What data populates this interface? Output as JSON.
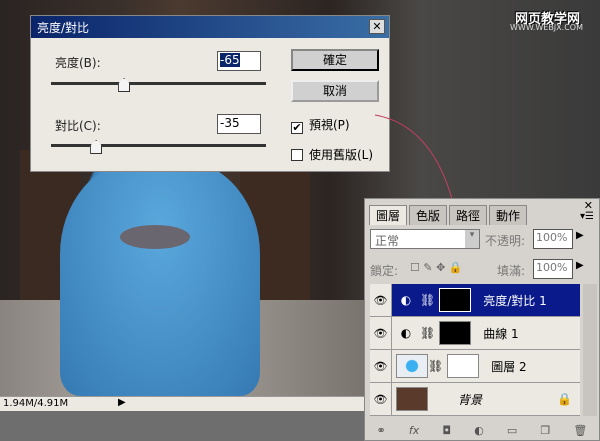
{
  "watermark": {
    "line1": "网页教学网",
    "line2": "WWW.WEBJX.COM"
  },
  "dialog": {
    "title": "亮度/對比",
    "close": "✕",
    "brightness_label": "亮度(B):",
    "brightness_value": "-65",
    "contrast_label": "對比(C):",
    "contrast_value": "-35",
    "brightness_slider_fraction": 0.34,
    "contrast_slider_fraction": 0.21,
    "ok": "確定",
    "cancel": "取消",
    "preview": "預視(P)",
    "preview_checked": true,
    "legacy": "使用舊版(L)",
    "legacy_checked": false
  },
  "status": {
    "doc_size": "1.94M/4.91M"
  },
  "layers": {
    "tabs": [
      "圖層",
      "色版",
      "路徑",
      "動作"
    ],
    "blend_mode": "正常",
    "opacity_label": "不透明:",
    "opacity": "100%",
    "lock_label": "鎖定:",
    "fill_label": "填滿:",
    "fill": "100%",
    "items": [
      {
        "name": "亮度/對比 1",
        "selected": true
      },
      {
        "name": "曲線 1"
      },
      {
        "name": "圖層 2"
      },
      {
        "name": "背景"
      }
    ],
    "footer_icons": [
      "link",
      "fx",
      "mask",
      "adjustment",
      "group",
      "new-layer",
      "trash"
    ]
  }
}
